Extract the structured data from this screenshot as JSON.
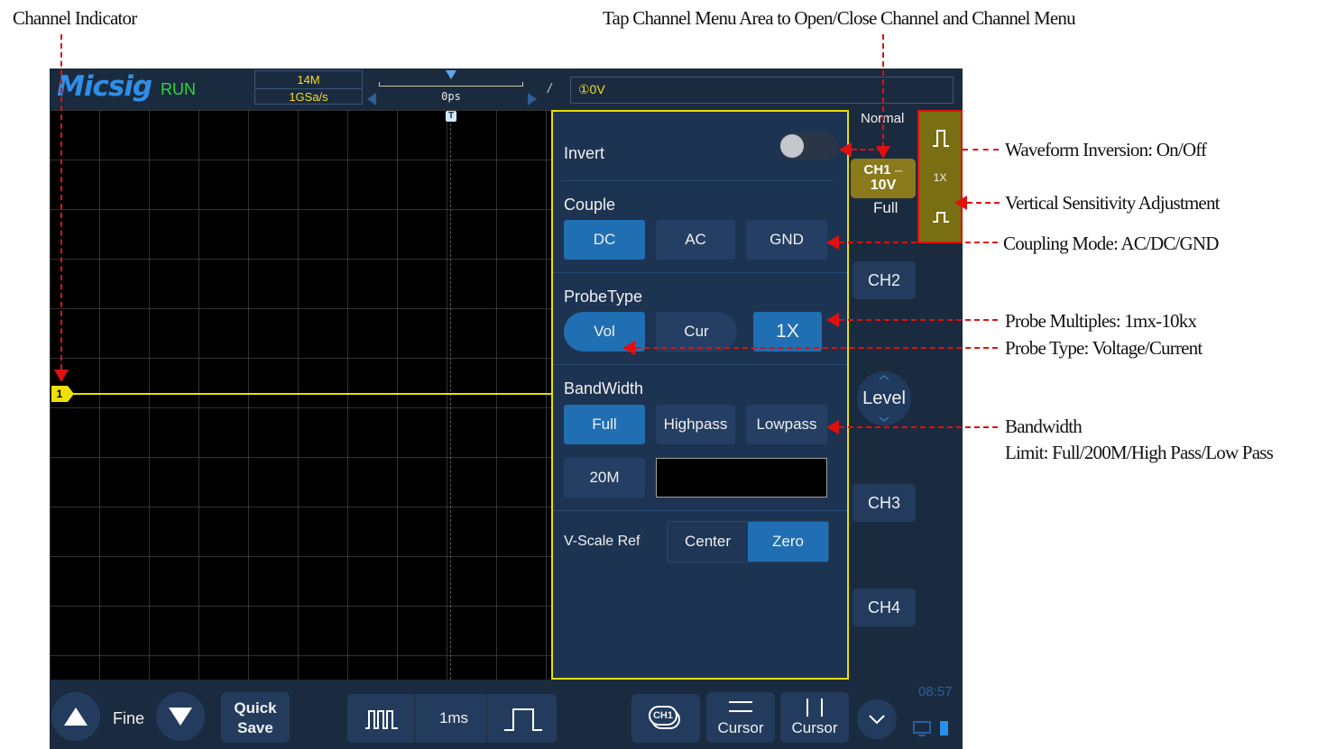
{
  "annotations": {
    "channel_indicator": "Channel Indicator",
    "tap_channel_menu": "Tap Channel Menu Area to Open/Close Channel and Channel Menu",
    "waveform_inversion": "Waveform Inversion: On/Off",
    "vertical_sensitivity": "Vertical Sensitivity Adjustment",
    "coupling_mode": "Coupling Mode: AC/DC/GND",
    "probe_multiples": "Probe Multiples: 1mx-10kx",
    "probe_type": "Probe Type: Voltage/Current",
    "bandwidth_line1": "Bandwidth",
    "bandwidth_line2": "Limit: Full/200M/High Pass/Low Pass"
  },
  "header": {
    "brand": "Micsig",
    "status": "RUN",
    "memory_depth": "14M",
    "sample_rate": "1GSa/s",
    "time_offset": "0ps",
    "trigger_slope": "/",
    "trigger_level": "①0V"
  },
  "screen": {
    "trigger_marker": "T",
    "channel_marker": "1"
  },
  "channel_menu": {
    "invert_label": "Invert",
    "invert_on": false,
    "couple_label": "Couple",
    "couple_options": [
      "DC",
      "AC",
      "GND"
    ],
    "couple_selected": "DC",
    "probe_label": "ProbeType",
    "probe_options": [
      "Vol",
      "Cur"
    ],
    "probe_selected": "Vol",
    "probe_multiple": "1X",
    "bandwidth_label": "BandWidth",
    "bandwidth_options": [
      "Full",
      "Highpass",
      "Lowpass"
    ],
    "bandwidth_selected": "Full",
    "bandwidth_20m": "20M",
    "vscale_label": "V-Scale Ref",
    "vscale_options": [
      "Center",
      "Zero"
    ],
    "vscale_selected": "Zero"
  },
  "side_panel": {
    "acq_mode": "Normal",
    "ch1_label": "CH1",
    "ch1_coupling_symbol": "⎓",
    "ch1_scale": "10V",
    "ch1_bandwidth": "Full",
    "ch1_probe": "1X",
    "ch2": "CH2",
    "level": "Level",
    "ch3": "CH3",
    "ch4": "CH4",
    "clock": "08:57"
  },
  "bottom_bar": {
    "fine_label": "Fine",
    "quick_save_line1": "Quick",
    "quick_save_line2": "Save",
    "timebase": "1ms",
    "ch_select": "CH1",
    "cursor1": "Cursor",
    "cursor2": "Cursor"
  },
  "colors": {
    "accent_yellow": "#e6e000",
    "active_blue": "#1f6fb2",
    "annotation_red": "#e01010",
    "scope_bg": "#1b2b3f"
  }
}
